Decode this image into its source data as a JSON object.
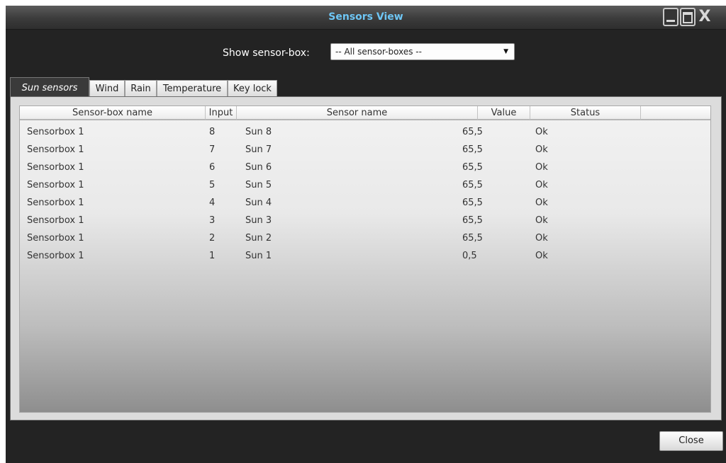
{
  "window": {
    "title": "Sensors View",
    "controls": {
      "minimize": "minimize",
      "maximize": "maximize",
      "close_glyph": "X"
    }
  },
  "filter": {
    "label": "Show sensor-box:",
    "selected": "-- All sensor-boxes --"
  },
  "tabs": [
    {
      "label": "Sun sensors",
      "active": true
    },
    {
      "label": "Wind",
      "active": false
    },
    {
      "label": "Rain",
      "active": false
    },
    {
      "label": "Temperature",
      "active": false
    },
    {
      "label": "Key lock",
      "active": false
    }
  ],
  "table": {
    "columns": [
      "Sensor-box name",
      "Input",
      "Sensor name",
      "Value",
      "Status"
    ],
    "rows": [
      [
        "Sensorbox 1",
        "8",
        "Sun 8",
        "65,5",
        "Ok"
      ],
      [
        "Sensorbox 1",
        "7",
        "Sun 7",
        "65,5",
        "Ok"
      ],
      [
        "Sensorbox 1",
        "6",
        "Sun 6",
        "65,5",
        "Ok"
      ],
      [
        "Sensorbox 1",
        "5",
        "Sun 5",
        "65,5",
        "Ok"
      ],
      [
        "Sensorbox 1",
        "4",
        "Sun 4",
        "65,5",
        "Ok"
      ],
      [
        "Sensorbox 1",
        "3",
        "Sun 3",
        "65,5",
        "Ok"
      ],
      [
        "Sensorbox 1",
        "2",
        "Sun 2",
        "65,5",
        "Ok"
      ],
      [
        "Sensorbox 1",
        "1",
        "Sun 1",
        "0,5",
        "Ok"
      ]
    ]
  },
  "footer": {
    "close_label": "Close"
  },
  "colors": {
    "title": "#6ec6f5",
    "window_bg": "#232323",
    "active_tab_bg": "#3a3a3a"
  }
}
